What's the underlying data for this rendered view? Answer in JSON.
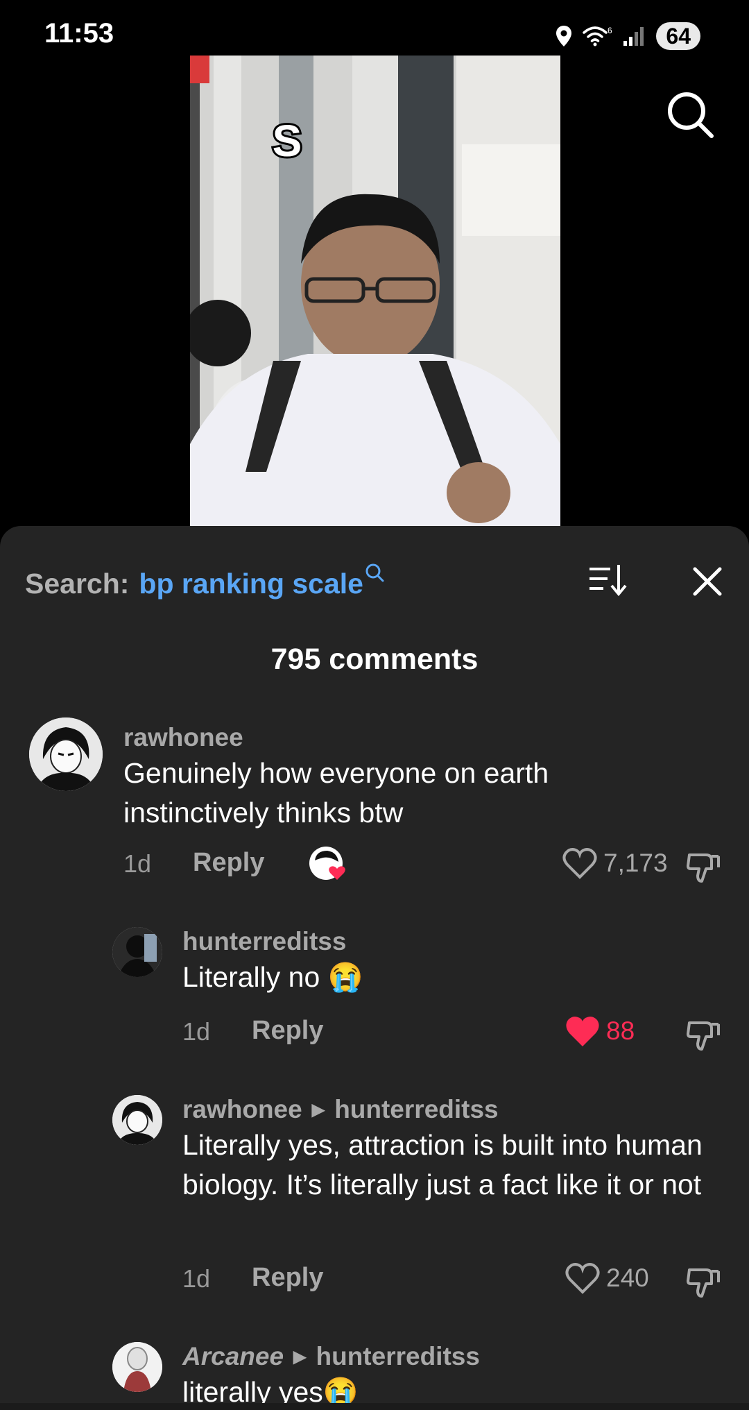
{
  "status": {
    "time": "11:53",
    "battery": "64"
  },
  "video": {
    "caption_letter": "S"
  },
  "search": {
    "prefix": "Search:",
    "query": "bp ranking scale"
  },
  "comments_header": {
    "count_label": "795 comments"
  },
  "comments": [
    {
      "user": "rawhonee",
      "text": "Genuinely how everyone on earth instinctively thinks btw",
      "age": "1d",
      "reply_label": "Reply",
      "likes": "7,173",
      "liked": false
    },
    {
      "user": "hunterreditss",
      "text": "Literally no 😭",
      "age": "1d",
      "reply_label": "Reply",
      "likes": "88",
      "liked": true
    },
    {
      "user": "rawhonee",
      "reply_to": "hunterreditss",
      "text": "Literally yes, attraction is built into human biology. It’s literally just a fact like it or not",
      "age": "1d",
      "reply_label": "Reply",
      "likes": "240",
      "liked": false
    },
    {
      "user": "Arcanee",
      "reply_to": "hunterreditss",
      "text": "literally yes😭"
    }
  ],
  "colors": {
    "accent_blue": "#5aa6f5",
    "like_red": "#fe2c55",
    "sheet_bg": "#242424"
  }
}
